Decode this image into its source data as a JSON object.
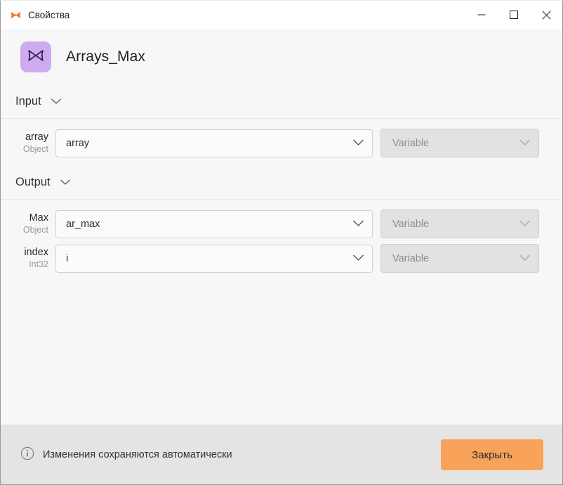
{
  "titlebar": {
    "icon": "butterfly-icon",
    "title": "Свойства",
    "minimize_label": "",
    "maximize_label": "",
    "close_label": ""
  },
  "header": {
    "badge_icon": "butterfly-icon",
    "title": "Arrays_Max"
  },
  "sections": [
    {
      "id": "input",
      "label": "Input",
      "chevron": "chevron-down-icon",
      "fields": [
        {
          "name": "array",
          "type": "Object",
          "value": "array",
          "kind": "Variable",
          "kind_disabled": true
        }
      ]
    },
    {
      "id": "output",
      "label": "Output",
      "chevron": "chevron-down-icon",
      "fields": [
        {
          "name": "Max",
          "type": "Object",
          "value": "ar_max",
          "kind": "Variable",
          "kind_disabled": true
        },
        {
          "name": "index",
          "type": "Int32",
          "value": "i",
          "kind": "Variable",
          "kind_disabled": true
        }
      ]
    }
  ],
  "footer": {
    "info_icon": "info-circle-icon",
    "note": "Изменения сохраняются автоматически",
    "close_button": "Закрыть"
  },
  "colors": {
    "accent_orange": "#f8a25a",
    "badge_purple": "#ceaaf0",
    "title_icon_orange": "#ef7a21",
    "footer_bg": "#e4e4e4",
    "body_bg": "#f7f7f7",
    "disabled_field": "#e2e2e2"
  }
}
